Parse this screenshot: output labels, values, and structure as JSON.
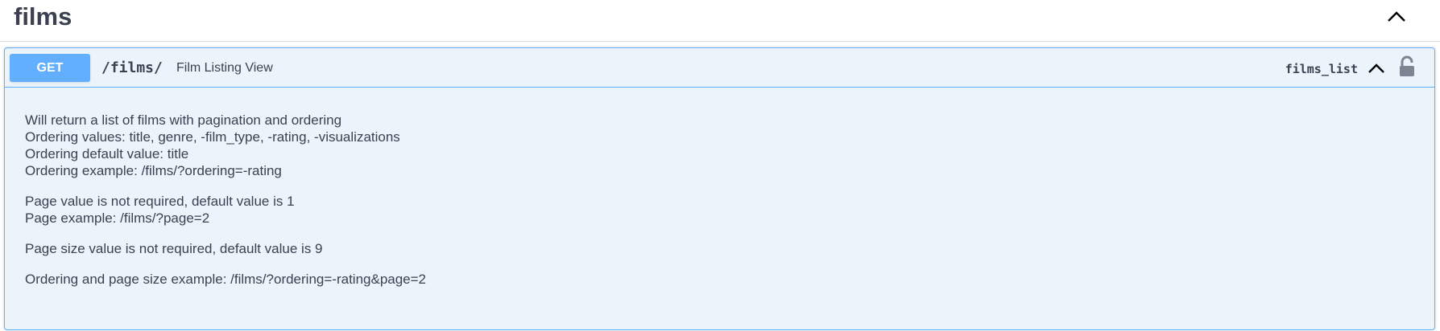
{
  "tag": {
    "title": "films"
  },
  "operation": {
    "method": "GET",
    "path": "/films/",
    "summary": "Film Listing View",
    "operation_id": "films_list",
    "description": {
      "paragraphs": [
        [
          "Will return a list of films with pagination and ordering",
          "Ordering values: title, genre, -film_type, -rating, -visualizations",
          "Ordering default value: title",
          "Ordering example: /films/?ordering=-rating"
        ],
        [
          "Page value is not required, default value is 1",
          "Page example: /films/?page=2"
        ],
        [
          "Page size value is not required, default value is 9"
        ],
        [
          "Ordering and page size example: /films/?ordering=-rating&page=2"
        ]
      ]
    }
  },
  "icons": {
    "tag_toggle": "chevron-up-icon",
    "op_toggle": "chevron-up-icon",
    "auth": "unlocked-padlock-icon"
  },
  "colors": {
    "get_accent": "#61affe",
    "get_background": "#ebf3fb",
    "text": "#3b4151",
    "lock": "#7d8492"
  }
}
